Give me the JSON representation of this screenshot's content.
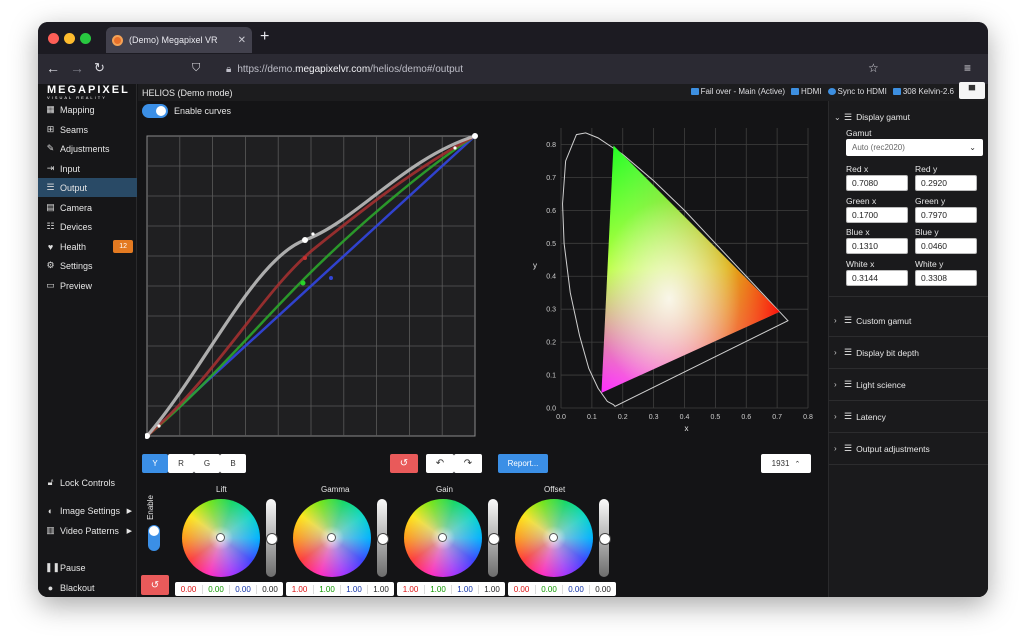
{
  "browser": {
    "tab_title": "(Demo) Megapixel VR",
    "url_prefix": "https://demo.",
    "url_domain": "megapixelvr.com",
    "url_path": "/helios/demo#/output"
  },
  "logo": {
    "name": "MEGAPIXEL",
    "tagline": "VISUAL REALITY"
  },
  "sidebar": {
    "items": [
      {
        "label": "Mapping",
        "icon": "grid-icon"
      },
      {
        "label": "Seams",
        "icon": "plus-box-icon"
      },
      {
        "label": "Adjustments",
        "icon": "pencil-icon"
      },
      {
        "label": "Input",
        "icon": "sign-in-icon"
      },
      {
        "label": "Output",
        "icon": "sliders-icon"
      },
      {
        "label": "Camera",
        "icon": "film-icon"
      },
      {
        "label": "Devices",
        "icon": "list-icon"
      },
      {
        "label": "Health",
        "icon": "heartbeat-icon",
        "badge": "12"
      },
      {
        "label": "Settings",
        "icon": "cogs-icon"
      },
      {
        "label": "Preview",
        "icon": "monitor-icon"
      }
    ],
    "bottom": [
      {
        "label": "Lock Controls"
      },
      {
        "label": "Image Settings"
      },
      {
        "label": "Video Patterns"
      },
      {
        "label": "Pause"
      },
      {
        "label": "Blackout"
      }
    ]
  },
  "topbar": {
    "title": "HELIOS (Demo mode)",
    "status": [
      "Fail over - Main (Active)",
      "HDMI",
      "Sync to HDMI",
      "308 Kelvin-2.6"
    ]
  },
  "curves": {
    "enable_label": "Enable curves",
    "channels": [
      "Y",
      "R",
      "G",
      "B"
    ],
    "active_channel": "Y",
    "report_label": "Report...",
    "cie_label": "1931"
  },
  "chart_data": {
    "type": "scatter",
    "xlabel": "x",
    "ylabel": "y",
    "xlim": [
      0,
      0.8
    ],
    "ylim": [
      0,
      0.85
    ],
    "x_ticks": [
      "0.0",
      "0.1",
      "0.2",
      "0.3",
      "0.4",
      "0.5",
      "0.6",
      "0.7",
      "0.8"
    ],
    "y_ticks": [
      "0.0",
      "0.1",
      "0.2",
      "0.3",
      "0.4",
      "0.5",
      "0.6",
      "0.7",
      "0.8"
    ],
    "gamut": [
      [
        0.708,
        0.292
      ],
      [
        0.17,
        0.797
      ],
      [
        0.131,
        0.046
      ]
    ]
  },
  "gamut_panel": {
    "display_gamut_label": "Display gamut",
    "gamut_label": "Gamut",
    "gamut_value": "Auto (rec2020)",
    "fields": [
      {
        "label": "Red x",
        "value": "0.7080"
      },
      {
        "label": "Red y",
        "value": "0.2920"
      },
      {
        "label": "Green x",
        "value": "0.1700"
      },
      {
        "label": "Green y",
        "value": "0.7970"
      },
      {
        "label": "Blue x",
        "value": "0.1310"
      },
      {
        "label": "Blue y",
        "value": "0.0460"
      },
      {
        "label": "White x",
        "value": "0.3144"
      },
      {
        "label": "White y",
        "value": "0.3308"
      }
    ],
    "sections": [
      "Custom gamut",
      "Display bit depth",
      "Light science",
      "Latency",
      "Output adjustments"
    ]
  },
  "wheels": {
    "enable_label": "Enable",
    "items": [
      {
        "label": "Lift",
        "values": [
          "0.00",
          "0.00",
          "0.00",
          "0.00"
        ]
      },
      {
        "label": "Gamma",
        "values": [
          "1.00",
          "1.00",
          "1.00",
          "1.00"
        ]
      },
      {
        "label": "Gain",
        "values": [
          "1.00",
          "1.00",
          "1.00",
          "1.00"
        ]
      },
      {
        "label": "Offset",
        "values": [
          "0.00",
          "0.00",
          "0.00",
          "0.00"
        ]
      }
    ]
  },
  "colors": {
    "accent": "#3b8fe6",
    "danger": "#e95a5a",
    "badge": "#e47a21"
  }
}
